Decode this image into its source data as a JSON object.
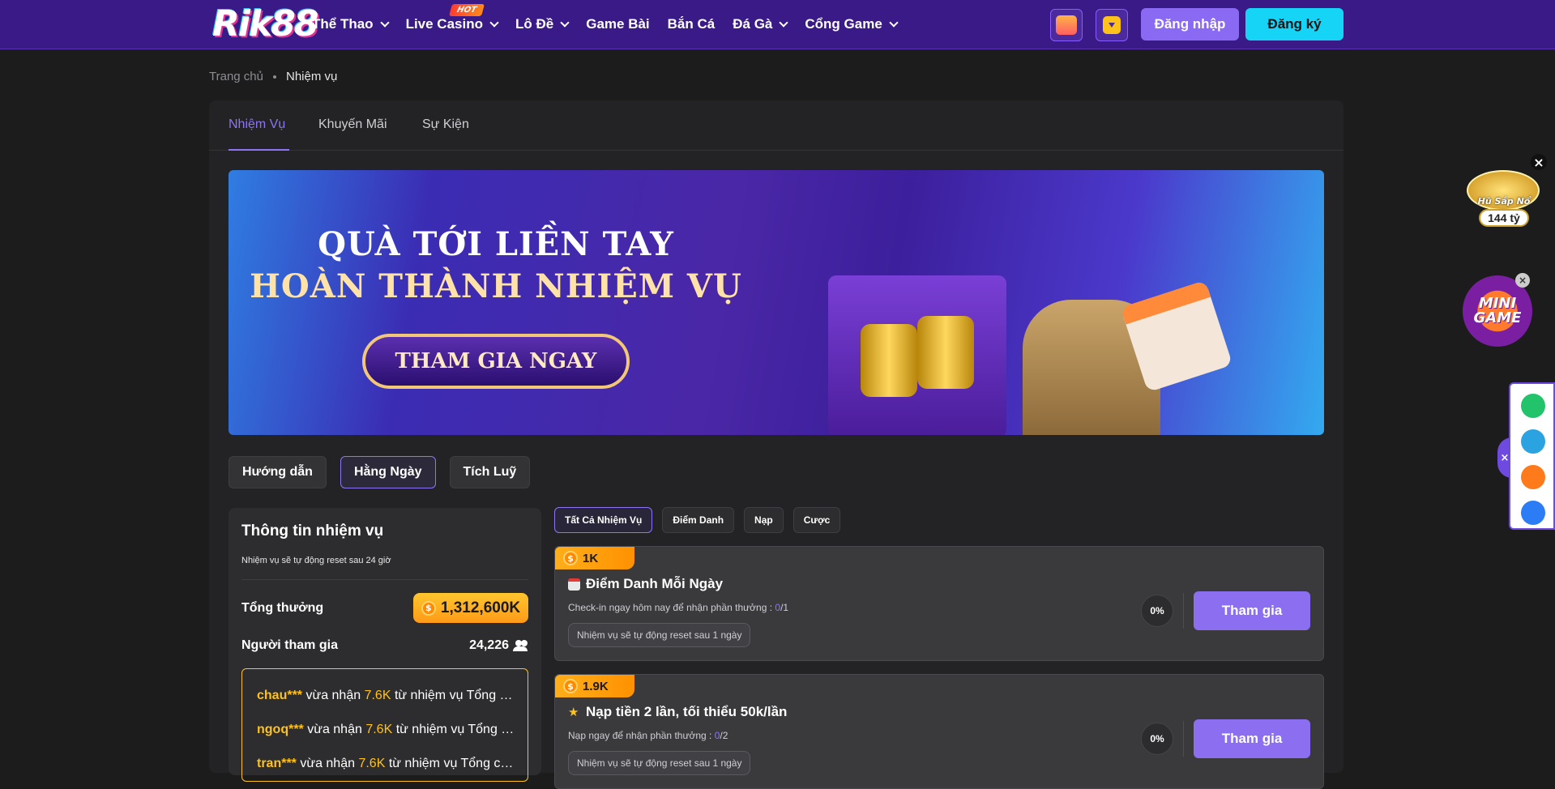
{
  "header": {
    "logo": "Rik88",
    "nav": [
      {
        "label": "Thể Thao",
        "dropdown": true
      },
      {
        "label": "Live Casino",
        "dropdown": true,
        "badge": "HOT"
      },
      {
        "label": "Lô Đề",
        "dropdown": true
      },
      {
        "label": "Game Bài",
        "dropdown": false
      },
      {
        "label": "Bắn Cá",
        "dropdown": false
      },
      {
        "label": "Đá Gà",
        "dropdown": true
      },
      {
        "label": "Cổng Game",
        "dropdown": true
      }
    ],
    "icons": [
      "gift-icon",
      "download-icon"
    ],
    "login_label": "Đăng nhập",
    "register_label": "Đăng ký",
    "colors": {
      "background": "#3a1a86",
      "login": "#8a6af3",
      "register": "#15d4f5"
    }
  },
  "breadcrumb": {
    "home": "Trang chủ",
    "current": "Nhiệm vụ"
  },
  "tabs": [
    {
      "label": "Nhiệm Vụ",
      "active": true
    },
    {
      "label": "Khuyến Mãi",
      "active": false
    },
    {
      "label": "Sự Kiện",
      "active": false
    }
  ],
  "banner": {
    "line1": "QUÀ TỚI LIỀN TAY",
    "line2": "HOÀN THÀNH NHIỆM VỤ",
    "cta": "THAM GIA NGAY"
  },
  "filters": [
    {
      "label": "Hướng dẫn",
      "active": false
    },
    {
      "label": "Hằng Ngày",
      "active": true
    },
    {
      "label": "Tích Luỹ",
      "active": false
    }
  ],
  "info": {
    "title": "Thông tin nhiệm vụ",
    "subtitle": "Nhiệm vụ sẽ tự động reset sau 24 giờ",
    "total_label": "Tổng thưởng",
    "total_value": "1,312,600K",
    "participants_label": "Người tham gia",
    "participants_value": "24,226",
    "feed": [
      {
        "user": "chau***",
        "mid": " vừa nhận ",
        "amount": "7.6K",
        "rest": " từ nhiệm vụ Tổng cược"
      },
      {
        "user": "ngoq***",
        "mid": " vừa nhận ",
        "amount": "7.6K",
        "rest": " từ nhiệm vụ Tổng cược"
      },
      {
        "user": "tran***",
        "mid": " vừa nhận ",
        "amount": "7.6K",
        "rest": " từ nhiệm vụ Tổng cược"
      }
    ]
  },
  "categories": [
    {
      "label": "Tất Cả Nhiệm Vụ",
      "active": true
    },
    {
      "label": "Điểm Danh",
      "active": false
    },
    {
      "label": "Nạp",
      "active": false
    },
    {
      "label": "Cược",
      "active": false
    }
  ],
  "tasks": [
    {
      "reward": "1K",
      "icon": "calendar-icon",
      "title": "Điểm Danh Mỗi Ngày",
      "desc": "Check-in ngay hôm nay để nhận phần thưởng : ",
      "progress_done": "0",
      "progress_total": "/1",
      "reset": "Nhiệm vụ sẽ tự động reset sau 1 ngày",
      "percent": "0%",
      "button": "Tham gia"
    },
    {
      "reward": "1.9K",
      "icon": "star-icon",
      "title": "Nạp tiền 2 lần, tối thiểu 50k/lần",
      "desc": "Nạp ngay để nhận phần thưởng : ",
      "progress_done": "0",
      "progress_total": "/2",
      "reset": "Nhiệm vụ sẽ tự động reset sau 1 ngày",
      "percent": "0%",
      "button": "Tham gia"
    }
  ],
  "floating": {
    "jackpot_label": "Hũ Sắp Nổ",
    "jackpot_amount": "144 tỷ",
    "minigame_label": "MINI GAME",
    "social_icons": [
      "chat-icon",
      "telegram-icon",
      "shop-icon",
      "messenger-icon"
    ]
  }
}
